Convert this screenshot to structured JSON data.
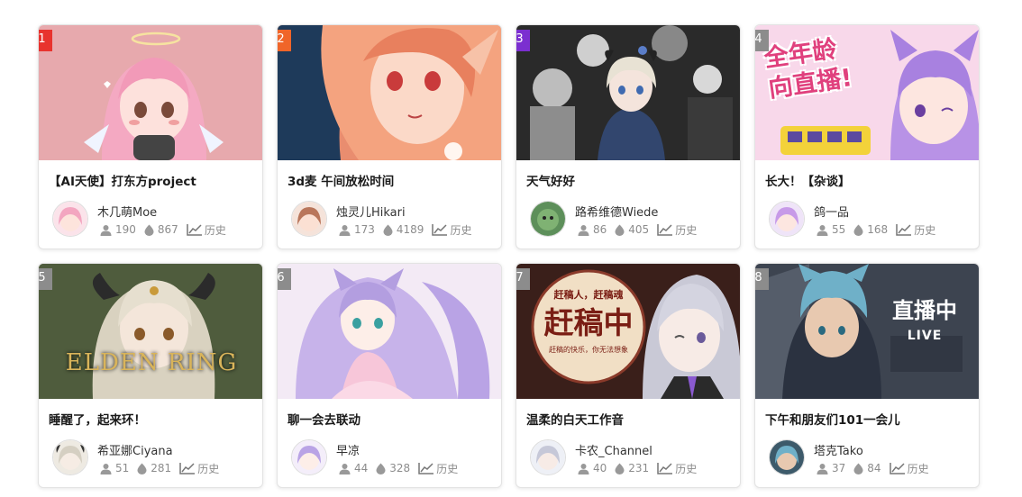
{
  "colors": {
    "rank_1": "#e8332e",
    "rank_2": "#f06529",
    "rank_3": "#7b2fd0",
    "rank_other": "#8c8c8c",
    "stat_text": "#8c8c8c"
  },
  "icons": {
    "viewers": "person-icon",
    "likes": "flame-icon",
    "history": "trend-line-icon"
  },
  "cards": [
    {
      "rank": "1",
      "title": "【AI天使】打东方project",
      "username": "木几萌Moe",
      "viewers": "190",
      "likes": "867",
      "history": "历史"
    },
    {
      "rank": "2",
      "title": "3d麦 午间放松时间",
      "username": "烛灵儿Hikari",
      "viewers": "173",
      "likes": "4189",
      "history": "历史"
    },
    {
      "rank": "3",
      "title": "天气好好",
      "username": "路希维德Wiede",
      "viewers": "86",
      "likes": "405",
      "history": "历史"
    },
    {
      "rank": "4",
      "title": "长大！【杂谈】",
      "username": "鸽一品",
      "viewers": "55",
      "likes": "168",
      "history": "历史",
      "thumb_text": [
        "全年龄",
        "向直播!"
      ]
    },
    {
      "rank": "5",
      "title": "睡醒了，起来环！",
      "username": "希亚娜Ciyana",
      "viewers": "51",
      "likes": "281",
      "history": "历史",
      "thumb_text": [
        "ELDEN RING"
      ]
    },
    {
      "rank": "6",
      "title": "聊一会去联动",
      "username": "早凉",
      "viewers": "44",
      "likes": "328",
      "history": "历史"
    },
    {
      "rank": "7",
      "title": "温柔的白天工作音",
      "username": "卡农_Channel",
      "viewers": "40",
      "likes": "231",
      "history": "历史",
      "thumb_text": [
        "赶稿人，赶稿魂",
        "赶稿中",
        "赶稿的快乐，你无法想象"
      ]
    },
    {
      "rank": "8",
      "title": "下午和朋友们101一会儿",
      "username": "塔克Tako",
      "viewers": "37",
      "likes": "84",
      "history": "历史",
      "thumb_text": [
        "直播中",
        "LIVE"
      ]
    }
  ]
}
